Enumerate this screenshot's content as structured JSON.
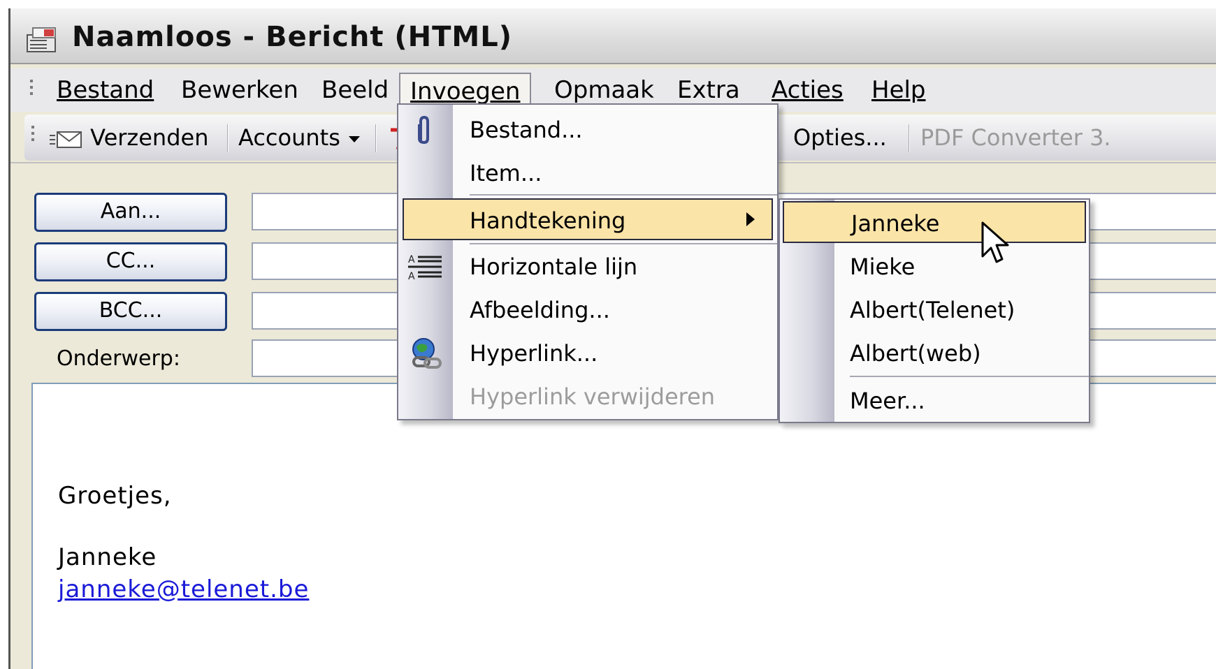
{
  "window": {
    "title": "Naamloos - Bericht (HTML)"
  },
  "menubar": {
    "items": [
      {
        "label": "Bestand"
      },
      {
        "label": "Bewerken"
      },
      {
        "label": "Beeld"
      },
      {
        "label": "Invoegen"
      },
      {
        "label": "Opmaak"
      },
      {
        "label": "Extra"
      },
      {
        "label": "Acties"
      },
      {
        "label": "Help"
      }
    ],
    "open_menu": "Invoegen"
  },
  "toolbar": {
    "send_label": "Verzenden",
    "accounts_label": "Accounts",
    "options_label": "Opties...",
    "pdf_label": "PDF Converter 3."
  },
  "form": {
    "to_label": "Aan...",
    "cc_label": "CC...",
    "bcc_label": "BCC...",
    "subject_label": "Onderwerp:",
    "to_value": "",
    "cc_value": "",
    "bcc_value": "",
    "subject_value": ""
  },
  "body": {
    "greeting": "Groetjes,",
    "name": "Janneke",
    "email": "janneke@telenet.be"
  },
  "invoegen_menu": {
    "items": [
      {
        "label": "Bestand...",
        "icon": "paperclip-icon"
      },
      {
        "label": "Item..."
      },
      {
        "label": "Handtekening",
        "highlighted": true,
        "has_submenu": true
      },
      {
        "label": "Horizontale lijn",
        "icon": "horizontal-line-icon"
      },
      {
        "label": "Afbeelding..."
      },
      {
        "label": "Hyperlink...",
        "icon": "hyperlink-globe-icon"
      },
      {
        "label": "Hyperlink verwijderen",
        "disabled": true
      }
    ]
  },
  "signature_submenu": {
    "items": [
      {
        "label": "Janneke",
        "highlighted": true
      },
      {
        "label": "Mieke"
      },
      {
        "label": "Albert(Telenet)"
      },
      {
        "label": "Albert(web)"
      },
      {
        "label": "Meer..."
      }
    ]
  },
  "colors": {
    "menu_highlight": "#fbe4a8",
    "link": "#1a1ad8",
    "button_border": "#1c3c7a"
  }
}
